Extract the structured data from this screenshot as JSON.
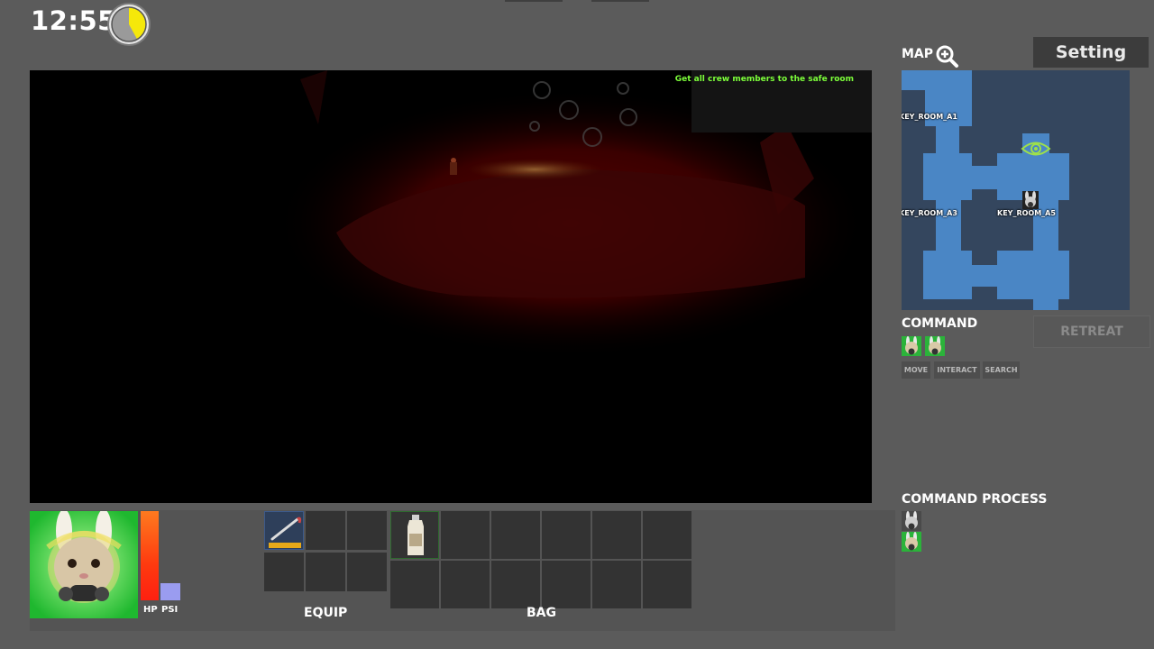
{
  "hud": {
    "clock": "12:55",
    "timer_progress": 0.42,
    "timer_color": "#f5e80a"
  },
  "viewport": {
    "objective": "Get all crew members to the safe room",
    "objective_color": "#7dff3a"
  },
  "map": {
    "title": "MAP",
    "zoom_icon": "zoom-in-icon",
    "room_labels": {
      "a1": "KEY_ROOM_A1",
      "a3": "KEY_ROOM_A3",
      "a5": "KEY_ROOM_A5"
    },
    "room_color": "#4a86c5",
    "marker_icon": "eye-icon"
  },
  "setting_label": "Setting",
  "command": {
    "title": "COMMAND",
    "retreat_label": "RETREAT",
    "buttons": [
      "MOVE",
      "INTERACT",
      "SEARCH"
    ]
  },
  "command_process": {
    "title": "COMMAND PROCESS"
  },
  "player": {
    "hp_label": "HP",
    "psi_label": "PSI",
    "hp_level": 1.0,
    "psi_level": 0.2,
    "hp_color": "#ff4a12",
    "psi_color": "#9a9cf0"
  },
  "inventory": {
    "equip_label": "EQUIP",
    "bag_label": "BAG",
    "equip_items": [
      "crowbar-icon"
    ],
    "bag_items": [
      "milk-bottle-icon"
    ]
  }
}
